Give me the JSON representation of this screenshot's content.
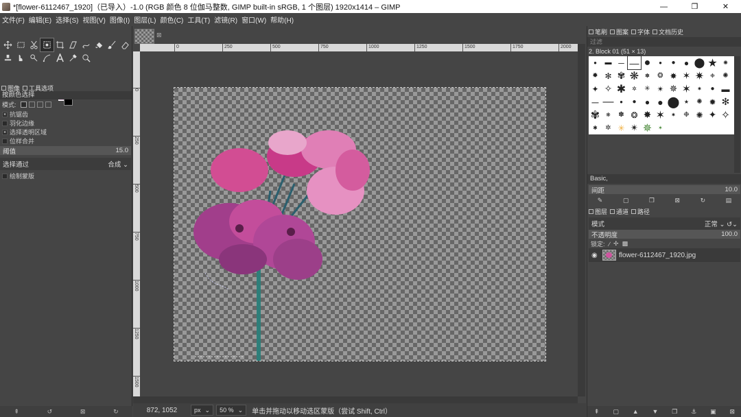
{
  "window": {
    "title": "*[flower-6112467_1920]（已导入）-1.0 (RGB 颜色 8 位伽马整数, GIMP built-in sRGB, 1 个图层) 1920x1414 – GIMP",
    "minimize": "—",
    "restore": "❐",
    "close": "✕"
  },
  "menu": [
    "文件(F)",
    "编辑(E)",
    "选择(S)",
    "视图(V)",
    "图像(I)",
    "图层(L)",
    "颜色(C)",
    "工具(T)",
    "滤镜(R)",
    "窗口(W)",
    "帮助(H)"
  ],
  "left_panel": {
    "tabs": [
      "图像",
      "工具选项"
    ],
    "tool_title": "按颜色选择",
    "mode_label": "模式:",
    "options": [
      "抗锯齿",
      "羽化边缘",
      "选择透明区域",
      "位样合并"
    ],
    "options_checked": [
      true,
      false,
      true,
      false
    ],
    "threshold": {
      "label": "阈值",
      "value": "15.0"
    },
    "select_by": {
      "label": "选择通过",
      "value": "合成"
    },
    "draw_mask": "绘制蒙版"
  },
  "rulers": {
    "h": [
      "250",
      "500",
      "750",
      "1000",
      "1250",
      "1500",
      "1750",
      "2000"
    ],
    "h0": "0",
    "v": [
      "0",
      "250",
      "500",
      "750",
      "1000",
      "1250",
      "1500"
    ]
  },
  "status": {
    "coords": "872, 1052",
    "unit": "px",
    "zoom": "50 %",
    "message": "单击并拖动以移动选区蒙版（尝试 Shift, Ctrl）"
  },
  "right_panel": {
    "tabs": [
      "笔刷",
      "图案",
      "字体",
      "文档历史"
    ],
    "filter_placeholder": "过滤",
    "brush_name": "2. Block 01 (51 × 13)",
    "preset": "Basic,",
    "spacing": {
      "label": "间距",
      "value": "10.0"
    },
    "layer_tabs": [
      "图层",
      "通道",
      "路径"
    ],
    "mode": {
      "label": "模式",
      "value": "正常"
    },
    "opacity": {
      "label": "不透明度",
      "value": "100.0"
    },
    "lock_label": "锁定:",
    "layer_name": "flower-6112467_1920.jpg"
  }
}
